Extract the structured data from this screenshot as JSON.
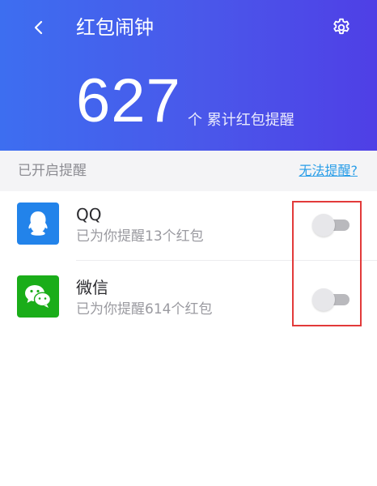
{
  "header": {
    "title": "红包闹钟",
    "back_icon": "chevron-left-icon",
    "settings_icon": "gear-icon",
    "count": "627",
    "count_label": "个 累计红包提醒"
  },
  "section": {
    "title": "已开启提醒",
    "help_link": "无法提醒?"
  },
  "apps": [
    {
      "name": "QQ",
      "subtitle": "已为你提醒13个红包",
      "icon": "qq-icon",
      "enabled": false
    },
    {
      "name": "微信",
      "subtitle": "已为你提醒614个红包",
      "icon": "wechat-icon",
      "enabled": false
    }
  ],
  "colors": {
    "header_start": "#3d6ef0",
    "header_end": "#4f3fe6",
    "qq_blue": "#2283ea",
    "wechat_green": "#1aad19",
    "link_blue": "#2a9ee8",
    "highlight_red": "#e23a3a"
  }
}
